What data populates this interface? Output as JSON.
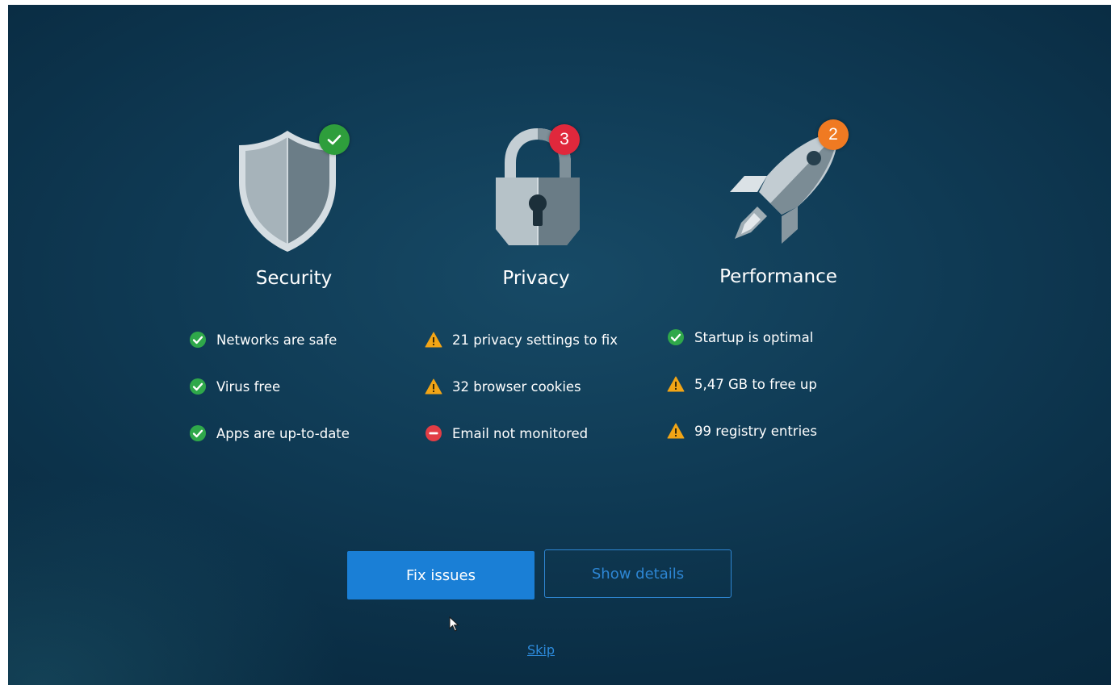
{
  "categories": [
    {
      "title": "Security",
      "icon": "shield-icon",
      "badge": {
        "type": "check",
        "color": "#2e9e3c"
      },
      "items": [
        {
          "status": "ok",
          "text": "Networks are safe"
        },
        {
          "status": "ok",
          "text": "Virus free"
        },
        {
          "status": "ok",
          "text": "Apps are up-to-date"
        }
      ]
    },
    {
      "title": "Privacy",
      "icon": "lock-icon",
      "badge": {
        "type": "count",
        "value": "3",
        "color": "#e0283c"
      },
      "items": [
        {
          "status": "warning",
          "text": "21 privacy settings to fix"
        },
        {
          "status": "warning",
          "text": "32 browser cookies"
        },
        {
          "status": "error",
          "text": "Email not monitored"
        }
      ]
    },
    {
      "title": "Performance",
      "icon": "rocket-icon",
      "badge": {
        "type": "count",
        "value": "2",
        "color": "#f07a22"
      },
      "items": [
        {
          "status": "ok",
          "text": "Startup is optimal"
        },
        {
          "status": "warning",
          "text": "5,47 GB to free up"
        },
        {
          "status": "warning",
          "text": "99 registry entries"
        }
      ]
    }
  ],
  "buttons": {
    "fix_label": "Fix issues",
    "details_label": "Show details",
    "skip_label": "Skip"
  },
  "colors": {
    "ok": "#2fa84a",
    "warning": "#f2a516",
    "error": "#e23d45",
    "primary": "#1a7fd6",
    "link": "#2d8bdc"
  }
}
